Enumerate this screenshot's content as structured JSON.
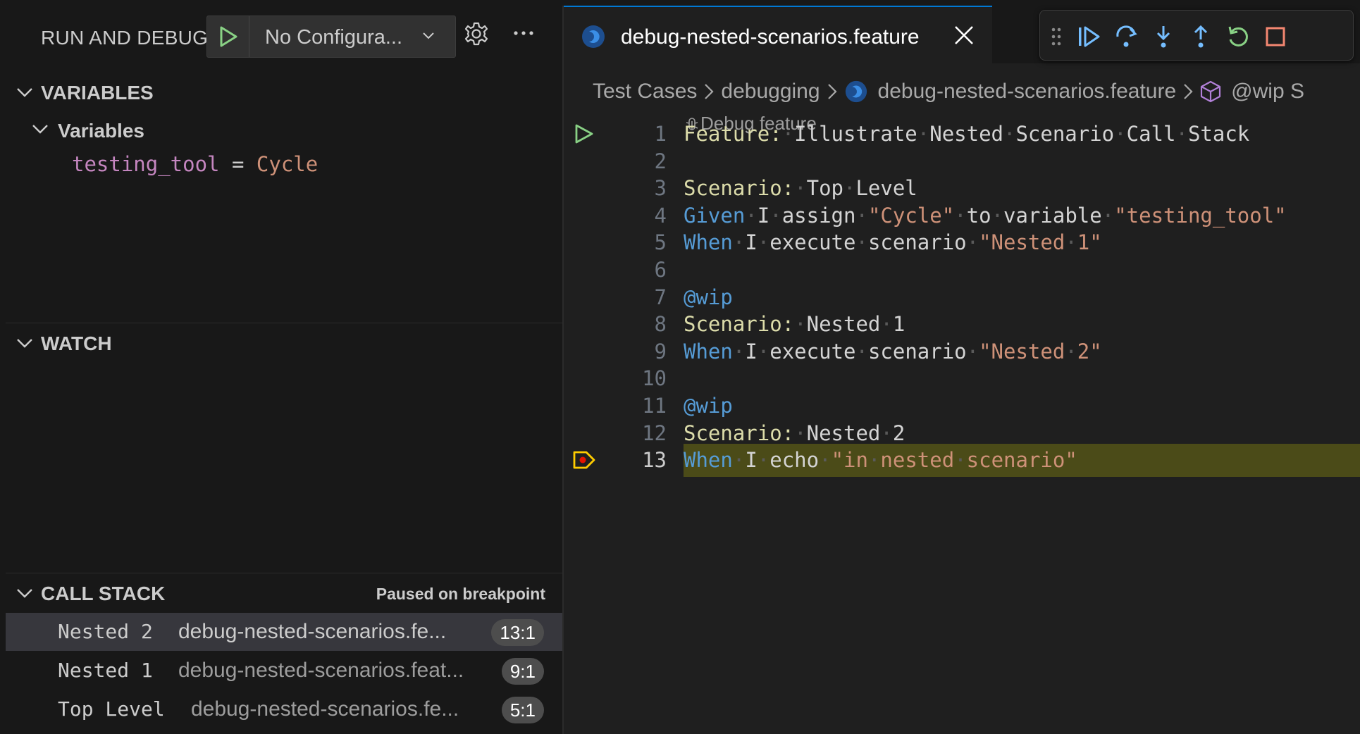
{
  "sidebar": {
    "title": "RUN AND DEBUG",
    "config_select": "No Configura...",
    "variables": {
      "header": "VARIABLES",
      "group_label": "Variables",
      "items": [
        {
          "name": "testing_tool",
          "eq": "=",
          "value": "Cycle"
        }
      ]
    },
    "watch": {
      "header": "WATCH"
    },
    "call_stack": {
      "header": "CALL STACK",
      "status": "Paused on breakpoint",
      "frames": [
        {
          "name": "Nested 2",
          "file": "debug-nested-scenarios.fe...",
          "position": "13:1",
          "selected": true
        },
        {
          "name": "Nested 1",
          "file": "debug-nested-scenarios.feat...",
          "position": "9:1",
          "selected": false
        },
        {
          "name": "Top Level",
          "file": "debug-nested-scenarios.fe...",
          "position": "5:1",
          "selected": false
        }
      ]
    }
  },
  "editor": {
    "tab": {
      "label": "debug-nested-scenarios.feature"
    },
    "breadcrumb": {
      "items": [
        "Test Cases",
        "debugging",
        "debug-nested-scenarios.feature",
        "@wip S"
      ]
    },
    "codelens": "Debug feature",
    "current_line": 13,
    "lines": [
      {
        "n": "1",
        "tokens": [
          [
            "kw2",
            "Feature:"
          ],
          [
            "ws",
            "·"
          ],
          [
            "",
            "Illustrate"
          ],
          [
            "ws",
            "·"
          ],
          [
            "",
            "Nested"
          ],
          [
            "ws",
            "·"
          ],
          [
            "",
            "Scenario"
          ],
          [
            "ws",
            "·"
          ],
          [
            "",
            "Call"
          ],
          [
            "ws",
            "·"
          ],
          [
            "",
            "Stack"
          ]
        ]
      },
      {
        "n": "2",
        "tokens": []
      },
      {
        "n": "3",
        "tokens": [
          [
            "kw2",
            "Scenario:"
          ],
          [
            "ws",
            "·"
          ],
          [
            "",
            "Top"
          ],
          [
            "ws",
            "·"
          ],
          [
            "",
            "Level"
          ]
        ]
      },
      {
        "n": "4",
        "tokens": [
          [
            "kw",
            "Given"
          ],
          [
            "ws",
            "·"
          ],
          [
            "",
            "I"
          ],
          [
            "ws",
            "·"
          ],
          [
            "",
            "assign"
          ],
          [
            "ws",
            "·"
          ],
          [
            "str",
            "\"Cycle\""
          ],
          [
            "ws",
            "·"
          ],
          [
            "",
            "to"
          ],
          [
            "ws",
            "·"
          ],
          [
            "",
            "variable"
          ],
          [
            "ws",
            "·"
          ],
          [
            "str",
            "\"testing_tool\""
          ]
        ]
      },
      {
        "n": "5",
        "tokens": [
          [
            "kw",
            "When"
          ],
          [
            "ws",
            "·"
          ],
          [
            "",
            "I"
          ],
          [
            "ws",
            "·"
          ],
          [
            "",
            "execute"
          ],
          [
            "ws",
            "·"
          ],
          [
            "",
            "scenario"
          ],
          [
            "ws",
            "·"
          ],
          [
            "str",
            "\"Nested"
          ],
          [
            "ws",
            "·"
          ],
          [
            "str",
            "1\""
          ]
        ]
      },
      {
        "n": "6",
        "tokens": []
      },
      {
        "n": "7",
        "tokens": [
          [
            "tag",
            "@wip"
          ]
        ]
      },
      {
        "n": "8",
        "tokens": [
          [
            "kw2",
            "Scenario:"
          ],
          [
            "ws",
            "·"
          ],
          [
            "",
            "Nested"
          ],
          [
            "ws",
            "·"
          ],
          [
            "",
            "1"
          ]
        ]
      },
      {
        "n": "9",
        "tokens": [
          [
            "kw",
            "When"
          ],
          [
            "ws",
            "·"
          ],
          [
            "",
            "I"
          ],
          [
            "ws",
            "·"
          ],
          [
            "",
            "execute"
          ],
          [
            "ws",
            "·"
          ],
          [
            "",
            "scenario"
          ],
          [
            "ws",
            "·"
          ],
          [
            "str",
            "\"Nested"
          ],
          [
            "ws",
            "·"
          ],
          [
            "str",
            "2\""
          ]
        ]
      },
      {
        "n": "10",
        "tokens": []
      },
      {
        "n": "11",
        "tokens": [
          [
            "tag",
            "@wip"
          ]
        ]
      },
      {
        "n": "12",
        "tokens": [
          [
            "kw2",
            "Scenario:"
          ],
          [
            "ws",
            "·"
          ],
          [
            "",
            "Nested"
          ],
          [
            "ws",
            "·"
          ],
          [
            "",
            "2"
          ]
        ]
      },
      {
        "n": "13",
        "tokens": [
          [
            "kw",
            "When"
          ],
          [
            "ws",
            "·"
          ],
          [
            "",
            "I"
          ],
          [
            "ws",
            "·"
          ],
          [
            "",
            "echo"
          ],
          [
            "ws",
            "·"
          ],
          [
            "str",
            "\"in"
          ],
          [
            "ws",
            "·"
          ],
          [
            "str",
            "nested"
          ],
          [
            "ws",
            "·"
          ],
          [
            "str",
            "scenario\""
          ]
        ]
      }
    ]
  },
  "colors": {
    "accent": "#0078d4",
    "run_green": "#89d185",
    "debug_blue": "#75beff",
    "stop_red": "#f48771",
    "breakpoint_yellow": "#ffcc00"
  }
}
